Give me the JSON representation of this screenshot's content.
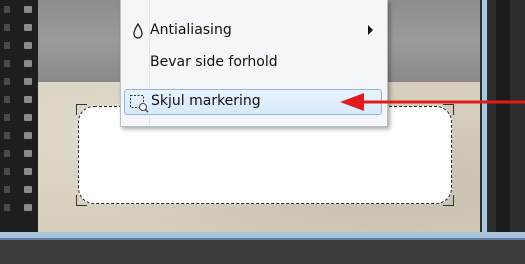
{
  "context_menu": {
    "items": [
      {
        "label": "Antialiasing",
        "icon": "droplet-icon",
        "has_submenu": true
      },
      {
        "label": "Bevar side forhold",
        "icon": "",
        "has_submenu": false
      },
      {
        "label": "Skjul markering",
        "icon": "hide-selection-icon",
        "has_submenu": false,
        "highlighted": true
      }
    ]
  },
  "colors": {
    "highlight_border": "#8fb7e0",
    "annotation_arrow": "#e31b1b",
    "frame": "#a9c6dd"
  }
}
